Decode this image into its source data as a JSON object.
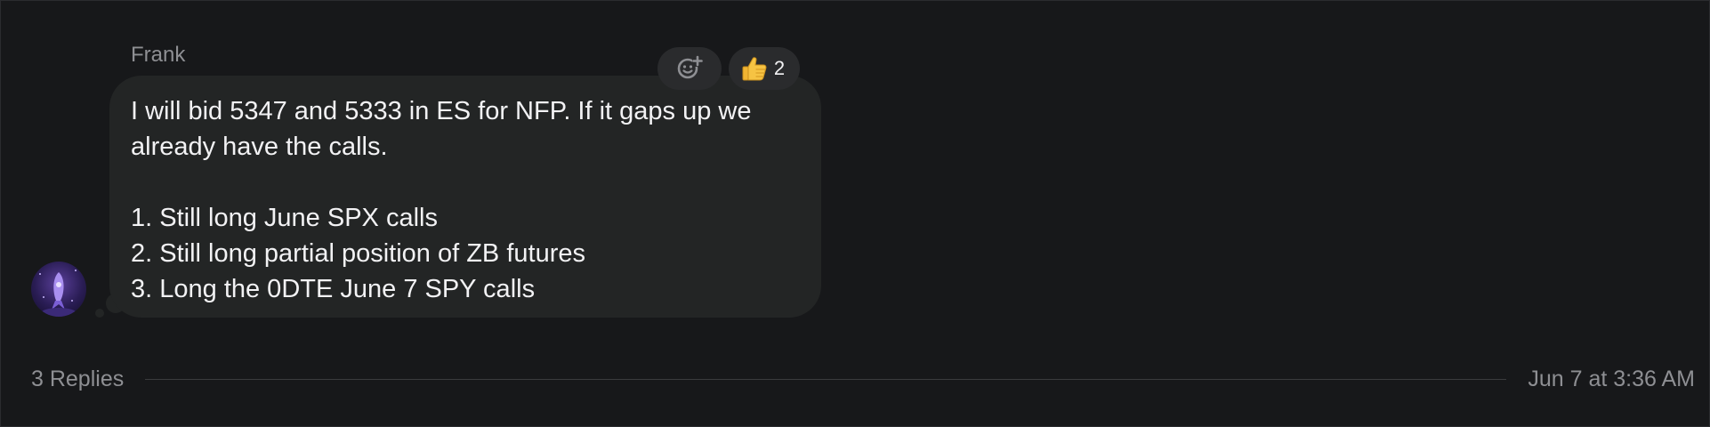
{
  "message": {
    "sender": "Frank",
    "lines": [
      "I will bid 5347 and 5333 in ES for NFP. If it gaps up we",
      "already have the calls.",
      "",
      "1. Still long June SPX calls",
      "2. Still long partial position of ZB futures",
      "3. Long the 0DTE June 7 SPY calls"
    ]
  },
  "reactions": {
    "add_icon": "add-reaction-icon",
    "thumbs_up": {
      "icon": "thumbs-up-emoji",
      "count": "2"
    }
  },
  "thread": {
    "replies_label": "3 Replies",
    "timestamp": "Jun 7 at 3:36 AM"
  },
  "colors": {
    "background": "#17181a",
    "bubble": "#232525",
    "text_primary": "#f2f2f4",
    "text_secondary": "#8e8f93"
  }
}
